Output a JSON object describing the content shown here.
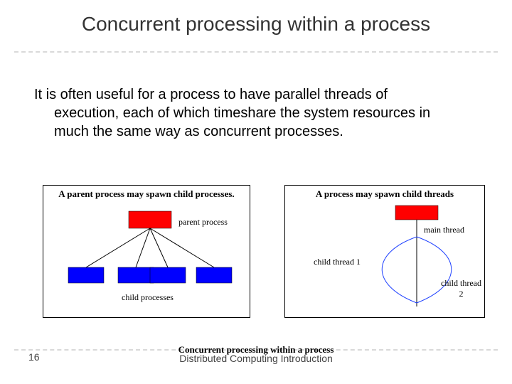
{
  "title": "Concurrent processing within a process",
  "body": {
    "line1": "It is often useful for a process to have parallel threads of",
    "rest": "execution, each of which timeshare the system resources in much the same way as concurrent processes."
  },
  "leftDiagram": {
    "title": "A parent process may spawn child processes.",
    "parentLabel": "parent process",
    "childrenLabel": "child processes"
  },
  "rightDiagram": {
    "title": "A process may spawn child threads",
    "mainLabel": "main thread",
    "child1Label": "child thread 1",
    "child2Label": "child thread 2"
  },
  "footer": {
    "pageNumber": "16",
    "subtitle": "Concurrent processing within a process",
    "main": "Distributed Computing Introduction"
  }
}
